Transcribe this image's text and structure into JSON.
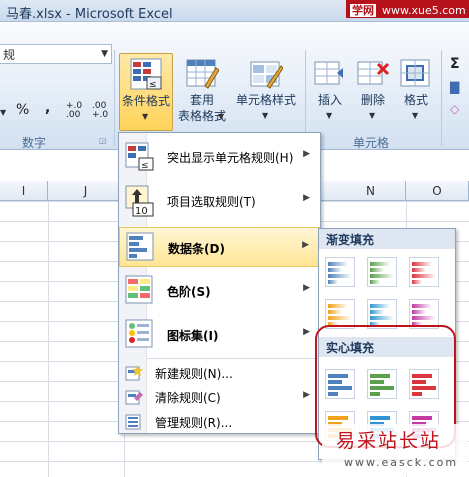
{
  "window": {
    "title": "马春.xlsx - Microsoft Excel"
  },
  "watermark": {
    "badge": "学网",
    "top_url": "www.xue5.com",
    "site_name": "易采站长站",
    "bottom_url": "www.easck.com"
  },
  "number_group": {
    "format_value": "规",
    "percent": "%",
    "comma": ",",
    "inc_decimal": "+.0 .00",
    "dec_decimal": ".00 +.0",
    "label": "数字"
  },
  "styles_group": {
    "conditional_formatting": "条件格式",
    "format_as_table_line1": "套用",
    "format_as_table_line2": "表格格式",
    "cell_styles": "单元格样式"
  },
  "cells_group": {
    "insert": "插入",
    "delete": "删除",
    "format": "格式",
    "label": "单元格"
  },
  "columns": [
    "I",
    "J",
    "N",
    "O"
  ],
  "cf_menu": {
    "items": [
      {
        "label": "突出显示单元格规则(H)"
      },
      {
        "label": "项目选取规则(T)"
      },
      {
        "label": "数据条(D)"
      },
      {
        "label": "色阶(S)"
      },
      {
        "label": "图标集(I)"
      }
    ],
    "small_items": [
      {
        "label": "新建规则(N)..."
      },
      {
        "label": "清除规则(C)"
      },
      {
        "label": "管理规则(R)..."
      }
    ]
  },
  "databar_submenu": {
    "gradient_header": "渐变填充",
    "solid_header": "实心填充",
    "colors": [
      "#4f81bd",
      "#5aa04e",
      "#d9363e",
      "#f0a21b",
      "#2f95d2",
      "#c23aa2"
    ],
    "annotation_color": "#c0141c"
  }
}
